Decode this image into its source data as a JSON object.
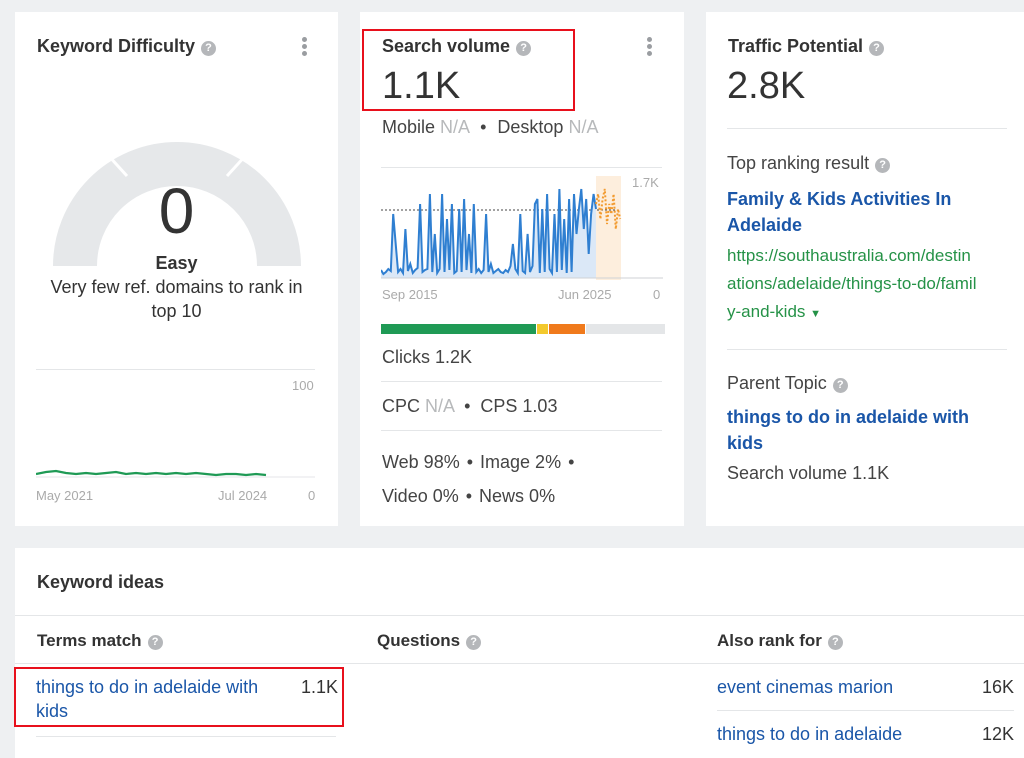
{
  "kd": {
    "title": "Keyword Difficulty",
    "value": "0",
    "label": "Easy",
    "description": "Very few ref. domains to rank in top 10",
    "chart_max": "100",
    "chart_min": "0",
    "x_start": "May 2021",
    "x_end": "Jul 2024",
    "line_color": "#1f9a55"
  },
  "sv": {
    "title": "Search volume",
    "value": "1.1K",
    "mobile_label": "Mobile",
    "mobile_value": "N/A",
    "desktop_label": "Desktop",
    "desktop_value": "N/A",
    "chart_max": "1.7K",
    "chart_min": "0",
    "x_start": "Sep 2015",
    "x_end": "Jun 2025",
    "clicks_label": "Clicks",
    "clicks_value": "1.2K",
    "cpc_label": "CPC",
    "cpc_value": "N/A",
    "cps_label": "CPS",
    "cps_value": "1.03",
    "web": "Web 98%",
    "image": "Image 2%",
    "video": "Video 0%",
    "news": "News 0%",
    "click_bar": [
      {
        "color": "#1f9a55",
        "fraction": 0.55
      },
      {
        "color": "#f3c92d",
        "fraction": 0.04
      },
      {
        "color": "#f07a1c",
        "fraction": 0.13
      },
      {
        "color": "#e4e6e8",
        "fraction": 0.28
      }
    ],
    "line_color": "#2f7fd1",
    "forecast_color": "#f29a2e"
  },
  "tp": {
    "title": "Traffic Potential",
    "value": "2.8K",
    "top_result_label": "Top ranking result",
    "top_result_title": "Family & Kids Activities In Adelaide",
    "top_result_url": "https://southaustralia.com/destinations/adelaide/things-to-do/family-and-kids",
    "url_lines": [
      "https://southaustralia.com/destin",
      "ations/adelaide/things-to-do/famil",
      "y-and-kids"
    ],
    "parent_topic_label": "Parent Topic",
    "parent_topic": "things to do in adelaide with kids",
    "parent_topic_lines": [
      "things to do in adelaide with",
      "kids"
    ],
    "parent_volume_label": "Search volume",
    "parent_volume": "1.1K"
  },
  "ideas": {
    "title": "Keyword ideas",
    "columns": [
      {
        "title": "Terms match",
        "rows": [
          {
            "keyword_lines": [
              "things to do in adelaide with",
              "kids"
            ],
            "volume": "1.1K"
          }
        ]
      },
      {
        "title": "Questions",
        "rows": []
      },
      {
        "title": "Also rank for",
        "rows": [
          {
            "keyword": "event cinemas marion",
            "volume": "16K"
          },
          {
            "keyword": "things to do in adelaide",
            "volume": "12K"
          }
        ]
      }
    ]
  }
}
